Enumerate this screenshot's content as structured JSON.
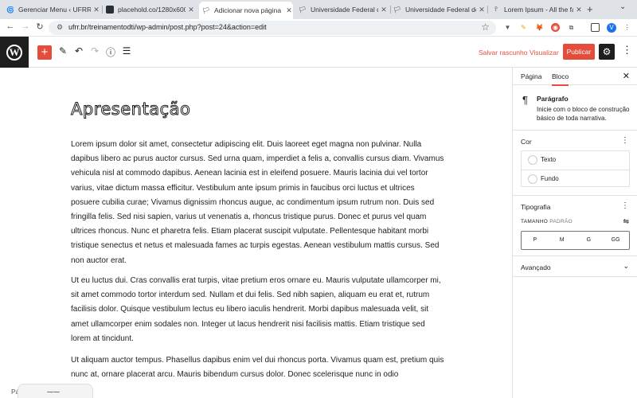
{
  "browser": {
    "tabs": [
      {
        "title": "Gerenciar Menu ‹ UFRR",
        "icon": "ufrr-favicon"
      },
      {
        "title": "placehold.co/1280x600/b",
        "icon": "placeholder-favicon"
      },
      {
        "title": "Adicionar nova página ‹ Tr",
        "icon": "wp-favicon",
        "active": true
      },
      {
        "title": "Universidade Federal de R",
        "icon": "ufrr-favicon"
      },
      {
        "title": "Universidade Federal de R",
        "icon": "ufrr-favicon"
      },
      {
        "title": "Lorem Ipsum - All the fact",
        "icon": "lipsum-favicon"
      }
    ],
    "url": "ufrr.br/treinamentodti/wp-admin/post.php?post=24&action=edit",
    "profile_initial": "V"
  },
  "editor": {
    "save_draft": "Salvar rascunho",
    "preview": "Visualizar",
    "publish": "Publicar",
    "accent": "#e54c3c"
  },
  "content": {
    "title": "Apresentação",
    "paragraphs": [
      "Lorem ipsum dolor sit amet, consectetur adipiscing elit. Duis laoreet eget magna non pulvinar. Nulla dapibus libero ac purus auctor cursus. Sed urna quam, imperdiet a felis a, convallis cursus diam. Vivamus vehicula nisl at commodo dapibus. Aenean lacinia est in eleifend posuere. Mauris lacinia dui vel tortor varius, vitae dictum massa efficitur. Vestibulum ante ipsum primis in faucibus orci luctus et ultrices posuere cubilia curae; Vivamus dignissim rhoncus augue, ac condimentum ipsum rutrum non. Duis sed fringilla felis. Sed nisi sapien, varius ut venenatis a, rhoncus tristique purus. Donec et purus vel quam ultrices rhoncus. Nunc et pharetra felis. Etiam placerat suscipit vulputate. Pellentesque habitant morbi tristique senectus et netus et malesuada fames ac turpis egestas. Aenean vestibulum mattis cursus. Sed non auctor erat.",
      "Ut eu luctus dui. Cras convallis erat turpis, vitae pretium eros ornare eu. Mauris vulputate ullamcorper mi, sit amet commodo tortor interdum sed. Nullam et dui felis. Sed nibh sapien, aliquam eu erat et, rutrum facilisis dolor. Quisque vestibulum lectus eu libero iaculis hendrerit. Morbi dapibus malesuada velit, sit amet ullamcorper enim sodales non. Integer ut lacus hendrerit nisi facilisis mattis. Etiam tristique sed lorem at tincidunt.",
      "Ut aliquam auctor tempus. Phasellus dapibus enim vel dui rhoncus porta. Vivamus quam est, pretium quis nunc at, ornare placerat arcu. Mauris bibendum cursus dolor. Donec scelerisque nunc in odio"
    ],
    "footer_crumb": "Pá"
  },
  "sidebar": {
    "tabs": [
      "Página",
      "Bloco"
    ],
    "block": {
      "name": "Parágrafo",
      "description": "Inicie com o bloco de construção básico de toda narrativa."
    },
    "color": {
      "title": "Cor",
      "items": [
        "Texto",
        "Fundo"
      ]
    },
    "typography": {
      "title": "Tipografia",
      "size_label": "TAMANHO",
      "size_value": "PADRÃO",
      "sizes": [
        "P",
        "M",
        "G",
        "GG"
      ]
    },
    "advanced": "Avançado"
  }
}
